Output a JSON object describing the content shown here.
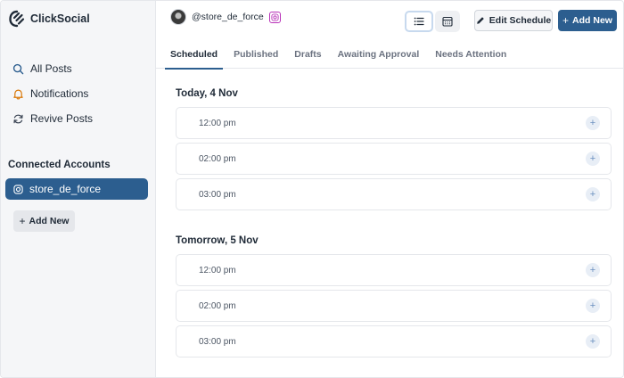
{
  "brand": {
    "name": "ClickSocial"
  },
  "sidebar": {
    "nav": [
      {
        "label": "All Posts",
        "icon": "search-icon"
      },
      {
        "label": "Notifications",
        "icon": "bell-icon"
      },
      {
        "label": "Revive Posts",
        "icon": "refresh-icon"
      }
    ],
    "section_title": "Connected Accounts",
    "account": {
      "name": "store_de_force",
      "icon": "instagram-icon"
    },
    "add_account_label": "Add New"
  },
  "header": {
    "profile_name": "@store_de_force",
    "edit_label": "Edit Schedule",
    "add_new_label": "Add New"
  },
  "tabs": [
    {
      "label": "Scheduled",
      "active": true
    },
    {
      "label": "Published"
    },
    {
      "label": "Drafts"
    },
    {
      "label": "Awaiting Approval"
    },
    {
      "label": "Needs Attention"
    }
  ],
  "days": [
    {
      "title": "Today, 4 Nov",
      "slots": [
        "12:00 pm",
        "02:00 pm",
        "03:00 pm"
      ]
    },
    {
      "title": "Tomorrow, 5 Nov",
      "slots": [
        "12:00 pm",
        "02:00 pm",
        "03:00 pm"
      ]
    }
  ],
  "colors": {
    "accent": "#2c5e8f",
    "sidebar_bg": "#f5f6f8",
    "instagram": "#b832b8"
  }
}
